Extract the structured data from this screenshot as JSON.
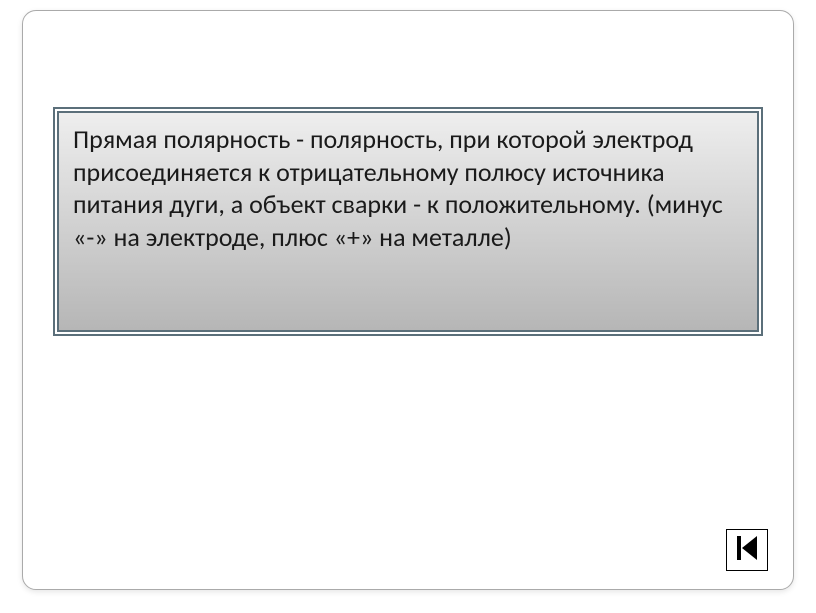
{
  "slide": {
    "definition_text": "Прямая полярность - полярность, при которой электрод присоединяется к отрицательному полюсу источника питания дуги, а объект сварки - к положительному. (минус «-» на электроде, плюс «+» на металле)"
  },
  "nav": {
    "icon": "previous-skip"
  }
}
